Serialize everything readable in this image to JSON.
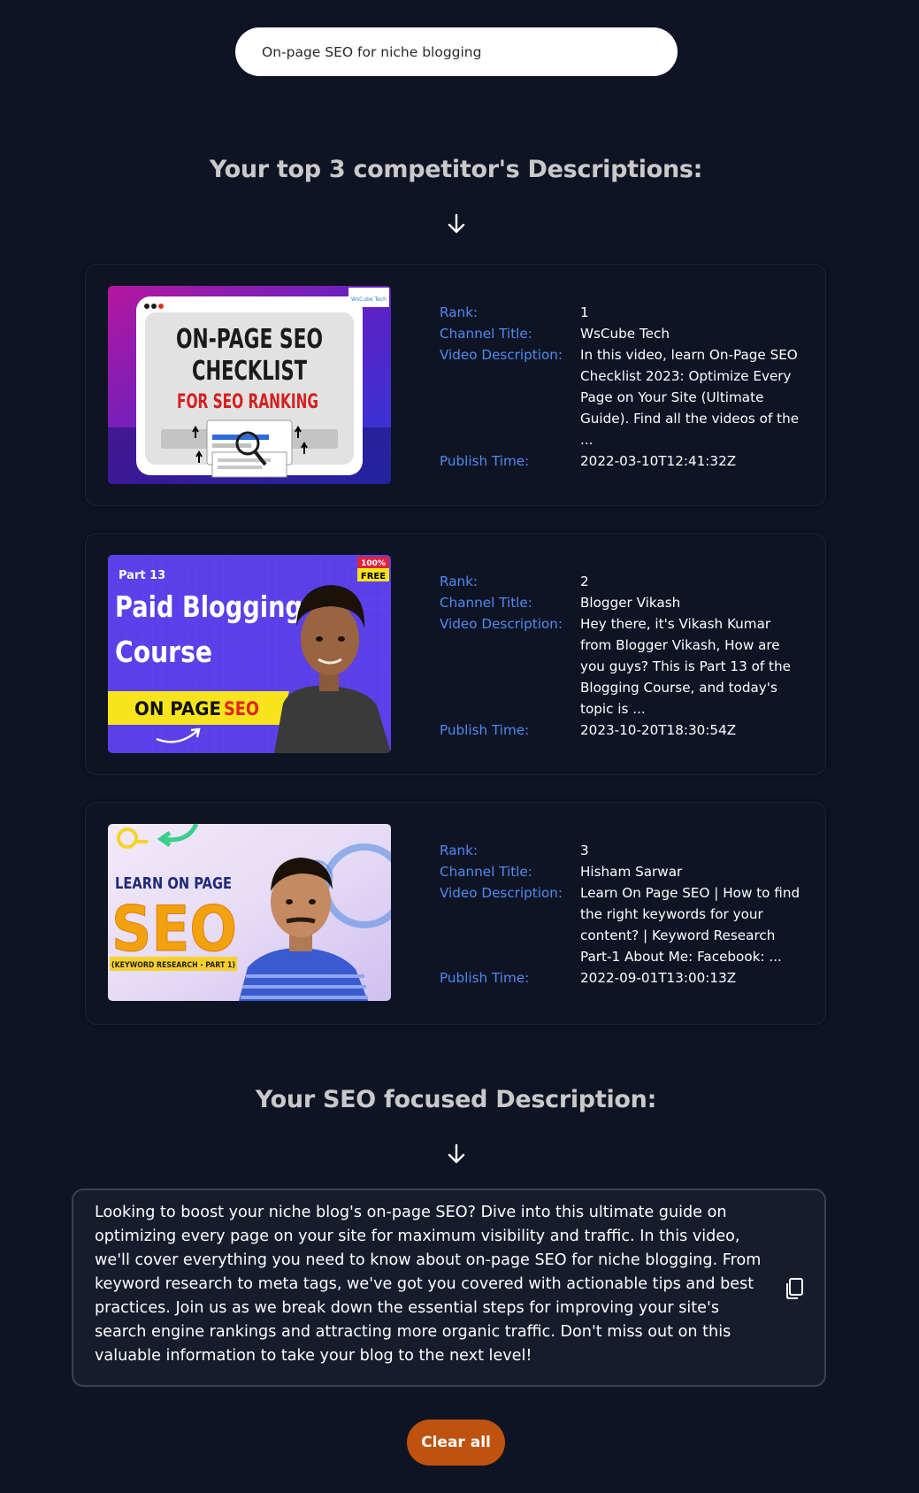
{
  "search": {
    "value": "On-page SEO for niche blogging"
  },
  "competitors_heading": "Your top 3 competitor's Descriptions:",
  "labels": {
    "rank": "Rank:",
    "channel_title": "Channel Title:",
    "video_description": "Video Description:",
    "publish_time": "Publish Time:"
  },
  "competitors": [
    {
      "rank": "1",
      "channel_title": "WsCube Tech",
      "video_description": "In this video, learn On-Page SEO Checklist 2023: Optimize Every Page on Your Site (Ultimate Guide). Find all the videos of the ...",
      "publish_time": "2022-03-10T12:41:32Z",
      "thumbnail": {
        "line1": "ON-PAGE SEO",
        "line2": "CHECKLIST",
        "line3": "FOR SEO RANKING",
        "brand": "WsCube Tech"
      }
    },
    {
      "rank": "2",
      "channel_title": "Blogger Vikash",
      "video_description": "Hey there, it's Vikash Kumar from Blogger Vikash, How are you guys? This is Part 13 of the Blogging Course, and today's topic is ...",
      "publish_time": "2023-10-20T18:30:54Z",
      "thumbnail": {
        "part": "Part 13",
        "line1": "Paid Blogging",
        "line2": "Course",
        "badge_top": "100%",
        "badge_bottom": "FREE",
        "banner_a": "ON PAGE",
        "banner_b": "SEO"
      }
    },
    {
      "rank": "3",
      "channel_title": "Hisham Sarwar",
      "video_description": "Learn On Page SEO | How to find the right keywords for your content? | Keyword Research Part-1 About Me: Facebook: ...",
      "publish_time": "2022-09-01T13:00:13Z",
      "thumbnail": {
        "line1": "LEARN ON PAGE",
        "line2": "SEO",
        "line3": "(KEYWORD RESEARCH - PART 1)"
      }
    }
  ],
  "seo_heading": "Your SEO focused Description:",
  "seo_description": "Looking to boost your niche blog's on-page SEO? Dive into this ultimate guide on optimizing every page on your site for maximum visibility and traffic. In this video, we'll cover everything you need to know about on-page SEO for niche blogging. From keyword research to meta tags, we've got you covered with actionable tips and best practices. Join us as we break down the essential steps for improving your site's search engine rankings and attracting more organic traffic. Don't miss out on this valuable information to take your blog to the next level!",
  "clear_button": "Clear all",
  "icons": {
    "arrow": "arrow-down-icon",
    "copy": "copy-icon"
  },
  "colors": {
    "background": "#0e1424",
    "label": "#4f8bf0",
    "heading": "#c9c9c9",
    "clear_button": "#c0520f"
  }
}
